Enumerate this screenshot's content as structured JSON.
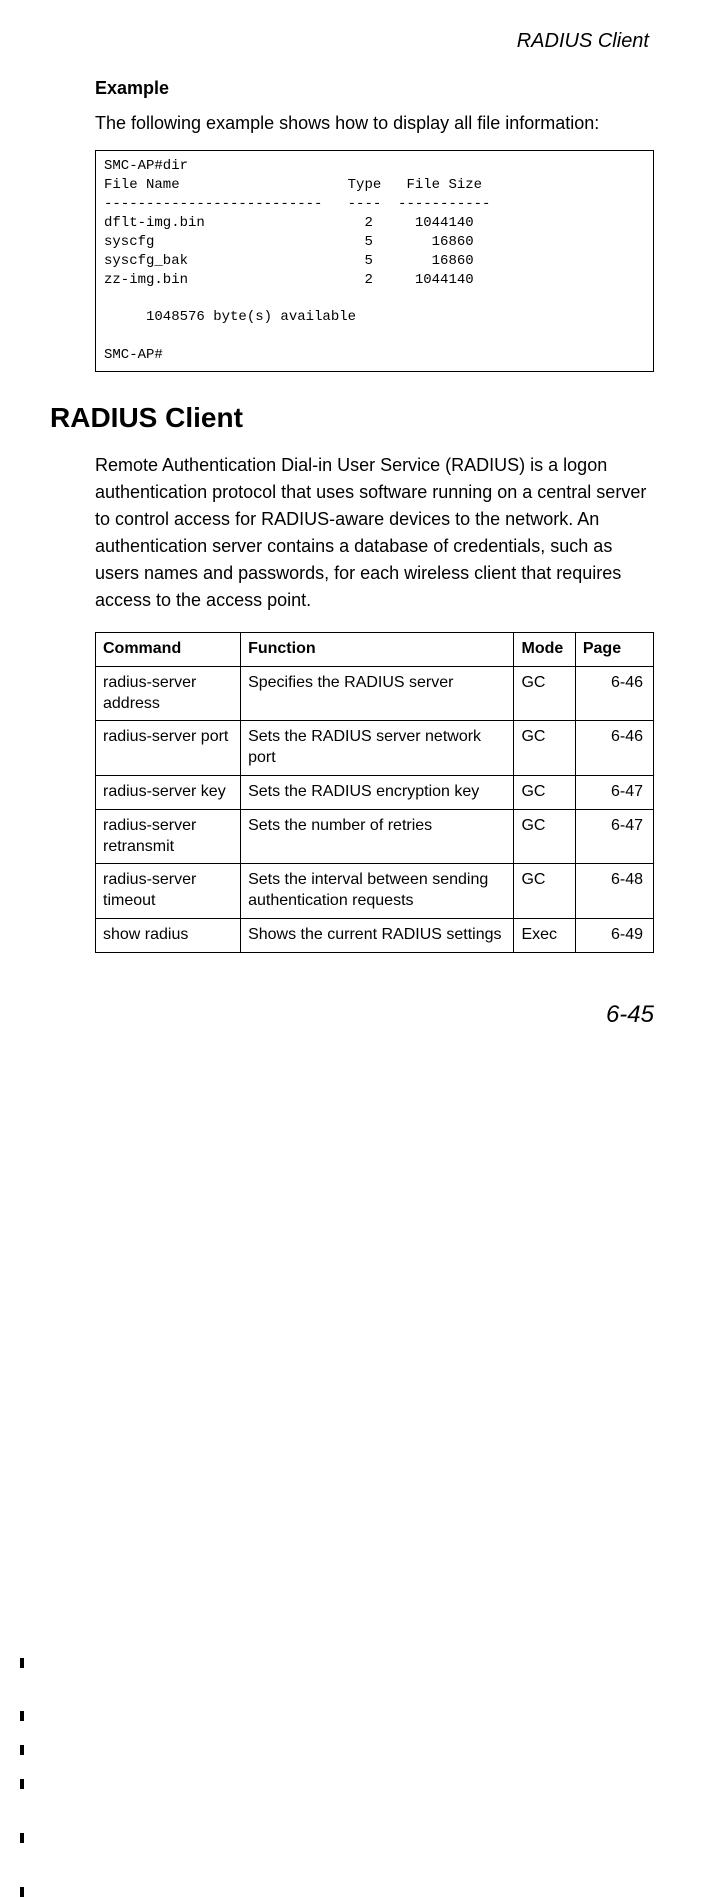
{
  "header": {
    "running_title": "RADIUS Client"
  },
  "example": {
    "heading": "Example",
    "intro": "The following example shows how to display all file information:",
    "code": "SMC-AP#dir\nFile Name                    Type   File Size\n--------------------------   ----  -----------\ndflt-img.bin                   2     1044140\nsyscfg                         5       16860\nsyscfg_bak                     5       16860\nzz-img.bin                     2     1044140\n\n     1048576 byte(s) available\n\nSMC-AP#"
  },
  "section": {
    "heading": "RADIUS Client",
    "text": "Remote Authentication Dial-in User Service (RADIUS) is a logon authentication protocol that uses software running on a central server to control access for RADIUS-aware devices to the network. An authentication server contains a database of credentials, such as users names and passwords, for each wireless client that requires access to the access point."
  },
  "table": {
    "headers": {
      "command": "Command",
      "function": "Function",
      "mode": "Mode",
      "page": "Page"
    },
    "rows": [
      {
        "command": "radius-server address",
        "function": "Specifies the RADIUS server",
        "mode": "GC",
        "page": "6-46"
      },
      {
        "command": "radius-server port",
        "function": "Sets the RADIUS server network port",
        "mode": "GC",
        "page": "6-46"
      },
      {
        "command": "radius-server key",
        "function": "Sets the RADIUS encryption key",
        "mode": "GC",
        "page": "6-47"
      },
      {
        "command": "radius-server retransmit",
        "function": "Sets the number of retries",
        "mode": "GC",
        "page": "6-47"
      },
      {
        "command": "radius-server timeout",
        "function": "Sets the interval between sending authentication requests",
        "mode": "GC",
        "page": "6-48"
      },
      {
        "command": "show radius",
        "function": "Shows the current RADIUS settings",
        "mode": "Exec",
        "page": "6-49"
      }
    ]
  },
  "page_number": "6-45"
}
